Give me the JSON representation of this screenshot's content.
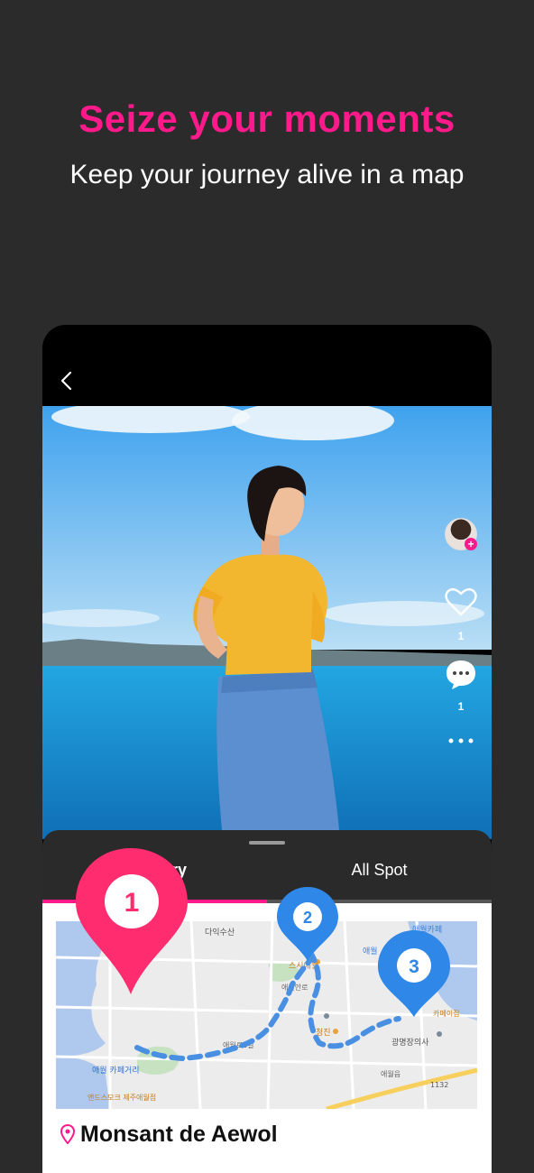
{
  "header": {
    "headline": "Seize your moments",
    "subline": "Keep your journey alive in a map"
  },
  "post": {
    "like_count": "1",
    "comment_count": "1"
  },
  "tabs": [
    {
      "label": "Itinerary",
      "active": true
    },
    {
      "label": "All Spot",
      "active": false
    }
  ],
  "map": {
    "pins": [
      {
        "number": "1",
        "color": "#ff2d6f"
      },
      {
        "number": "2",
        "color": "#2f87e8"
      },
      {
        "number": "3",
        "color": "#2f87e8"
      }
    ],
    "labels": [
      "다익수산",
      "애월카페",
      "애월",
      "스시애월",
      "애월안로",
      "애월로1길",
      "청진",
      "광명장의사",
      "애월 카페거리",
      "앤드스모크 제주애월점",
      "애월읍",
      "카페이집",
      "1132"
    ]
  },
  "place": {
    "name": "Monsant de Aewol"
  },
  "colors": {
    "accent": "#ff1a8c",
    "background": "#2b2b2b",
    "route": "#4a90e2"
  }
}
